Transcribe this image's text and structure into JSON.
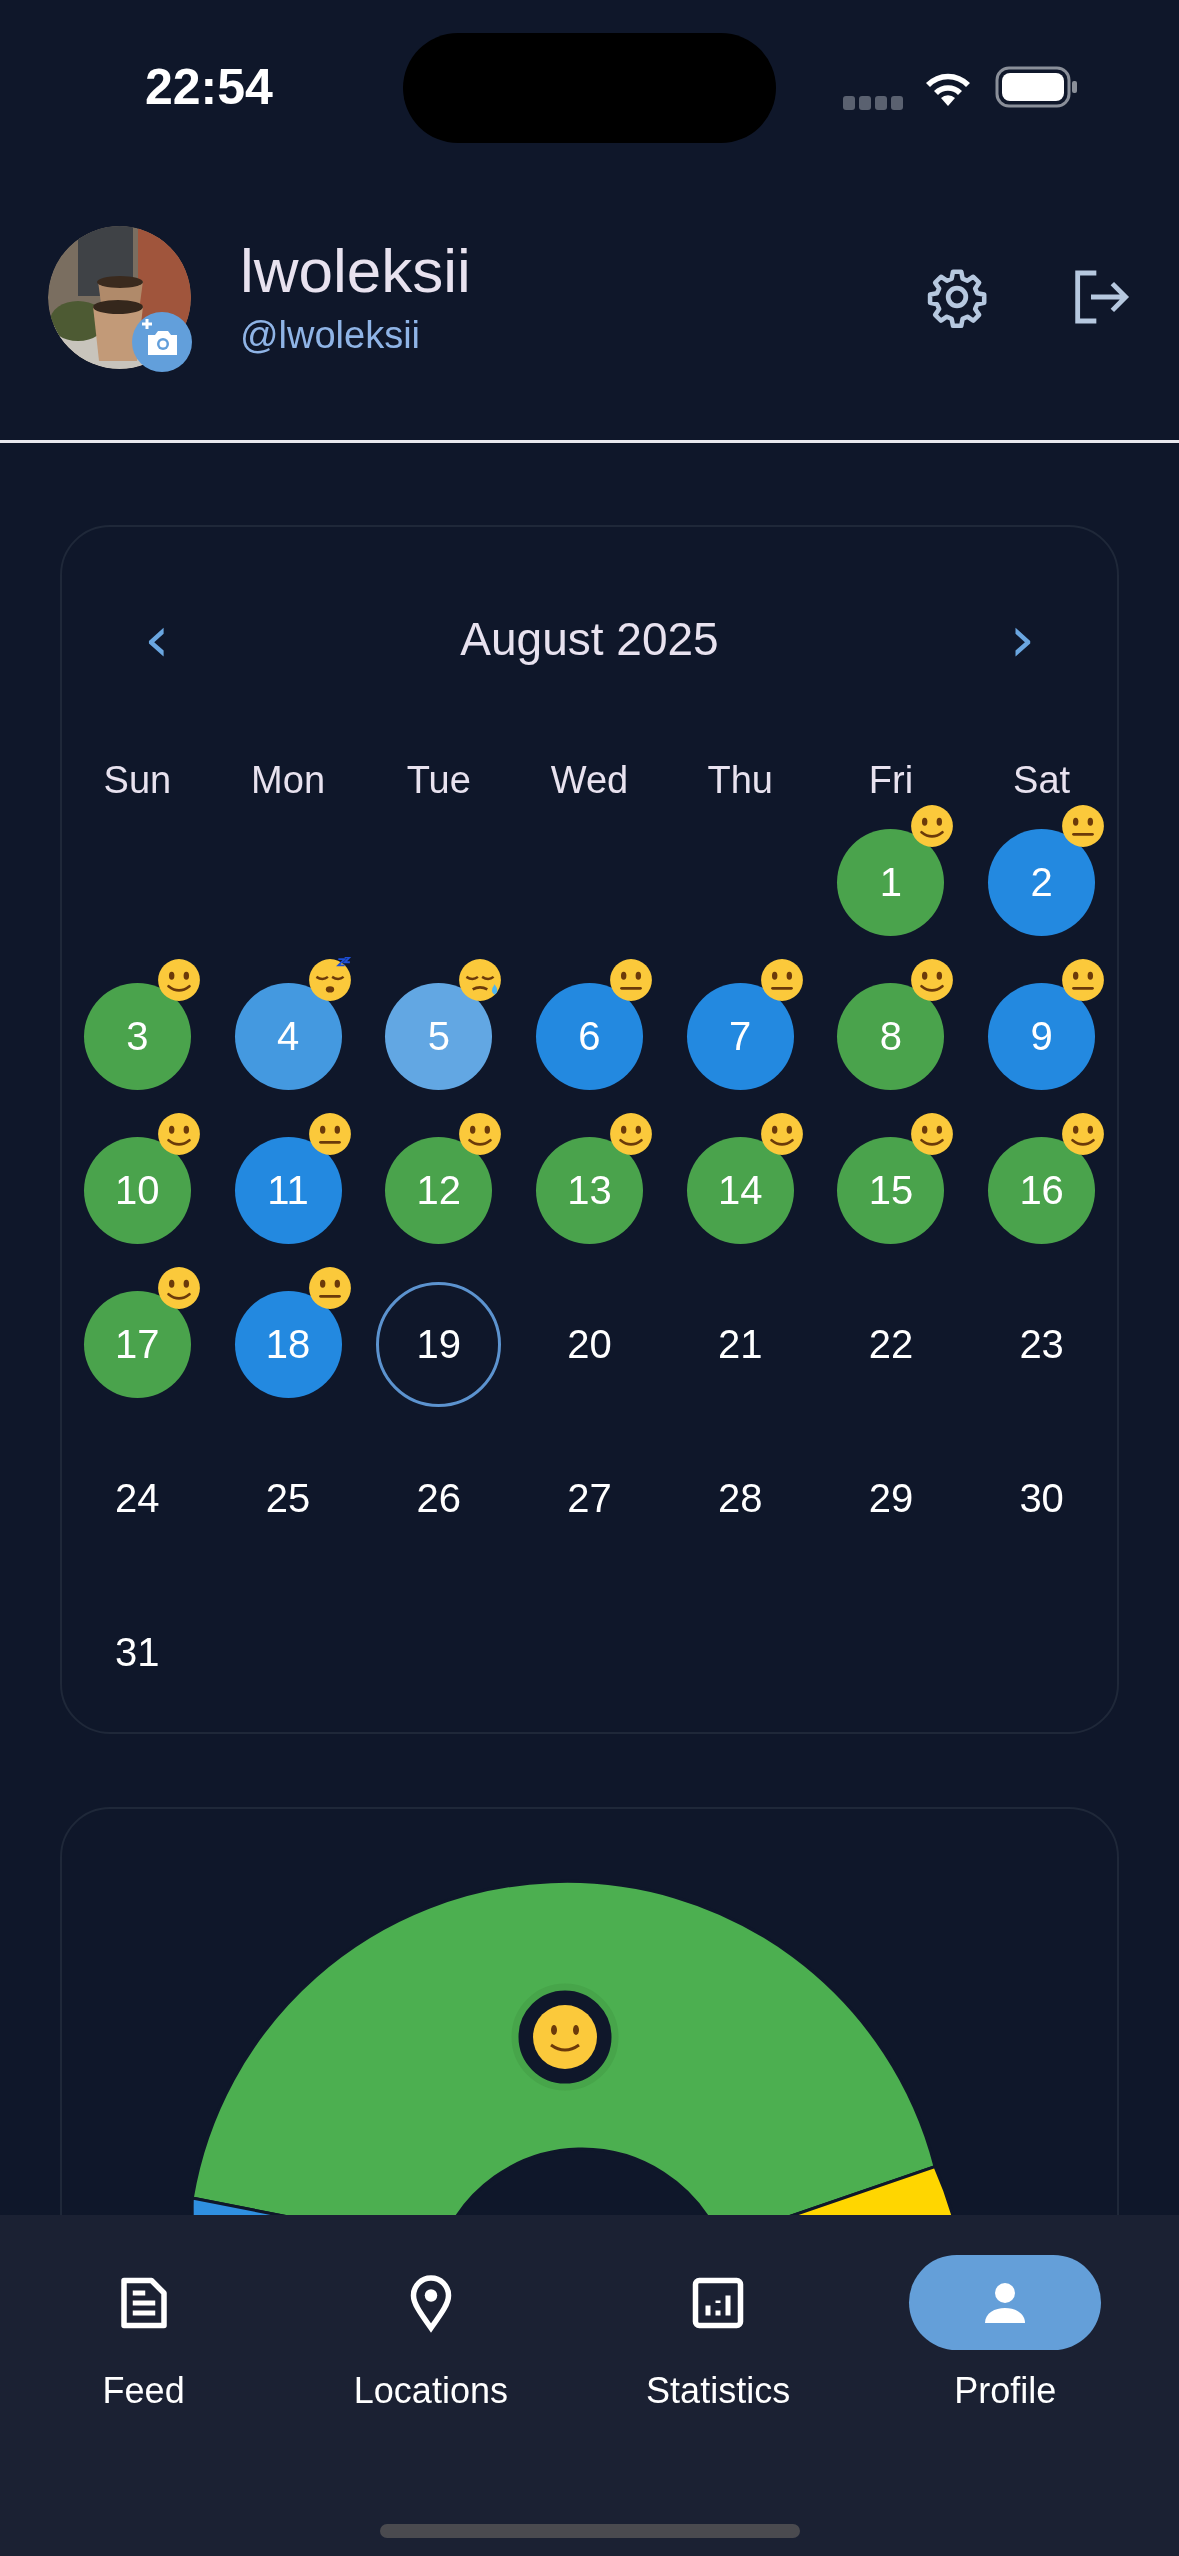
{
  "status_bar": {
    "time": "22:54"
  },
  "profile": {
    "name": "lwoleksii",
    "handle": "@lwoleksii"
  },
  "calendar": {
    "month": "August 2025",
    "prev": "‹",
    "next": "›",
    "weekdays": [
      "Sun",
      "Mon",
      "Tue",
      "Wed",
      "Thu",
      "Fri",
      "Sat"
    ],
    "weeks": [
      [
        {
          "day": "1",
          "kind": "happy",
          "color": "#4aa34c",
          "today": false
        },
        {
          "day": "2",
          "kind": "neutral",
          "color": "#2389e0",
          "today": false
        }
      ],
      [
        {
          "day": "3",
          "kind": "happy",
          "color": "#4aa34c",
          "today": false
        },
        {
          "day": "4",
          "kind": "sleeping",
          "color": "#4499e0",
          "today": false
        },
        {
          "day": "5",
          "kind": "sleepy",
          "color": "#62a7e3",
          "today": false
        },
        {
          "day": "6",
          "kind": "neutral",
          "color": "#2389e0",
          "today": false
        },
        {
          "day": "7",
          "kind": "neutral",
          "color": "#2389e0",
          "today": false
        },
        {
          "day": "8",
          "kind": "happy",
          "color": "#4aa34c",
          "today": false
        },
        {
          "day": "9",
          "kind": "neutral",
          "color": "#2389e0",
          "today": false
        }
      ],
      [
        {
          "day": "10",
          "kind": "happy",
          "color": "#4aa34c",
          "today": false
        },
        {
          "day": "11",
          "kind": "neutral",
          "color": "#2389e0",
          "today": false
        },
        {
          "day": "12",
          "kind": "happy",
          "color": "#4aa34c",
          "today": false
        },
        {
          "day": "13",
          "kind": "happy",
          "color": "#4aa34c",
          "today": false
        },
        {
          "day": "14",
          "kind": "happy",
          "color": "#4aa34c",
          "today": false
        },
        {
          "day": "15",
          "kind": "happy",
          "color": "#4aa34c",
          "today": false
        },
        {
          "day": "16",
          "kind": "happy",
          "color": "#4aa34c",
          "today": false
        }
      ],
      [
        {
          "day": "17",
          "kind": "happy",
          "color": "#4aa34c",
          "today": false
        },
        {
          "day": "18",
          "kind": "neutral",
          "color": "#2389e0",
          "today": false
        },
        {
          "day": "19",
          "today": true
        },
        {
          "day": "20",
          "today": false
        },
        {
          "day": "21",
          "today": false
        },
        {
          "day": "22",
          "today": false
        },
        {
          "day": "23",
          "today": false
        }
      ],
      [
        {
          "day": "24",
          "today": false
        },
        {
          "day": "25",
          "today": false
        },
        {
          "day": "26",
          "today": false
        },
        {
          "day": "27",
          "today": false
        },
        {
          "day": "28",
          "today": false
        },
        {
          "day": "29",
          "today": false
        },
        {
          "day": "30",
          "today": false
        }
      ],
      [
        {
          "day": "31",
          "today": false
        }
      ]
    ]
  },
  "nav": [
    {
      "label": "Feed",
      "kind": "feed",
      "selected": false
    },
    {
      "label": "Locations",
      "kind": "locations",
      "selected": false
    },
    {
      "label": "Statistics",
      "kind": "statistics",
      "selected": false
    },
    {
      "label": "Profile",
      "kind": "profile",
      "selected": true
    }
  ]
}
